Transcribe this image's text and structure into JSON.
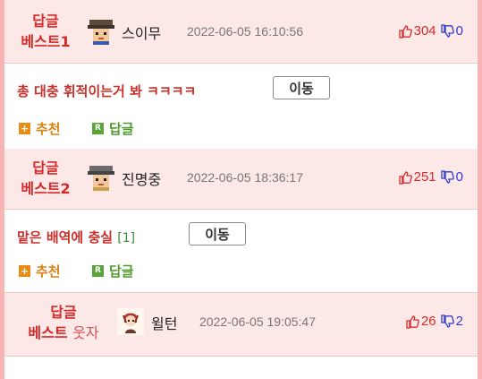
{
  "comments": [
    {
      "rank_line1": "답글",
      "rank_line2": "베스트1",
      "author": "스이무",
      "date": "2022-06-05 16:10:56",
      "upvotes": "304",
      "downvotes": "0",
      "text": "총 대충 휘적이는거 봐 ㅋㅋㅋㅋ",
      "reply_count": "",
      "move_label": "이동",
      "recommend_label": "추천",
      "reply_label": "답글"
    },
    {
      "rank_line1": "답글",
      "rank_line2": "베스트2",
      "author": "진명중",
      "date": "2022-06-05 18:36:17",
      "upvotes": "251",
      "downvotes": "0",
      "text": "맡은 배역에 충실",
      "reply_count": "[1]",
      "move_label": "이동",
      "recommend_label": "추천",
      "reply_label": "답글"
    },
    {
      "rank_line1": "답글",
      "rank_line2": "베스트",
      "rank_suffix": "웃자",
      "author": "윌턴",
      "date": "2022-06-05 19:05:47",
      "upvotes": "26",
      "downvotes": "2"
    }
  ],
  "icons": {
    "recommend_icon": "+",
    "reply_icon": "R"
  },
  "colors": {
    "header_bg": "#fde8e8",
    "rank_red": "#d42a2a",
    "upvote_red": "#d42a2a",
    "downvote_blue": "#2d3bc9",
    "recommend_orange": "#d9820f",
    "reply_green": "#4e9a2e",
    "frame_pink": "#f6b4b4"
  }
}
